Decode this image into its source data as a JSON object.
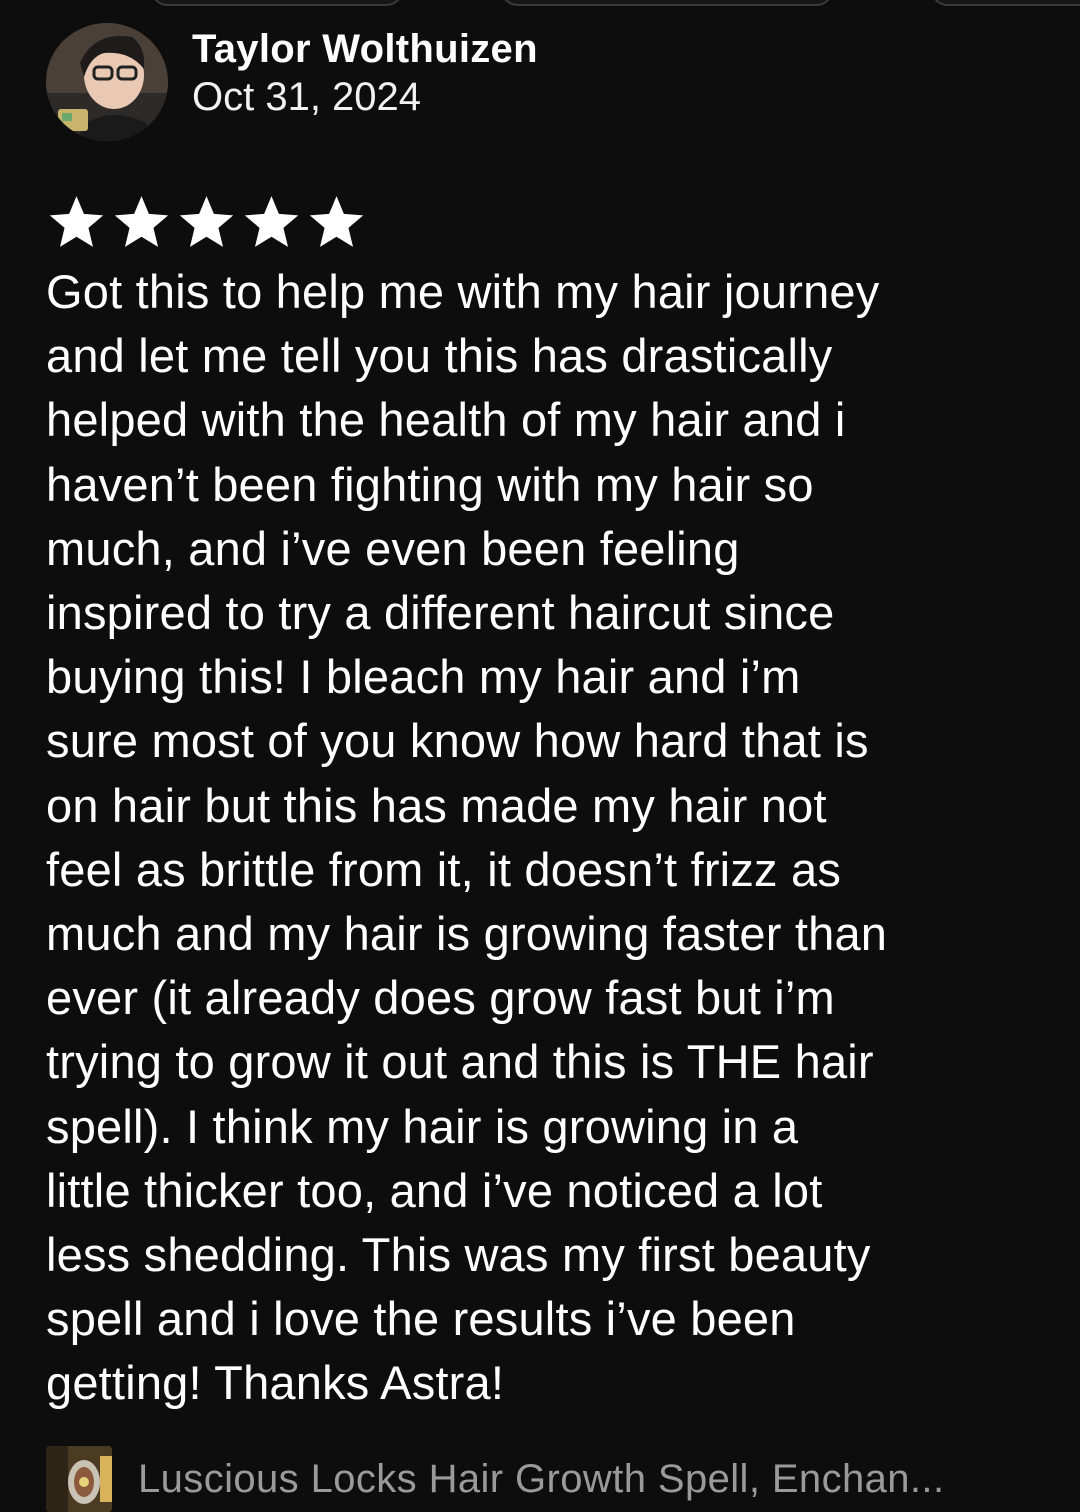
{
  "review": {
    "reviewer_name": "Taylor Wolthuizen",
    "date": "Oct 31, 2024",
    "rating": 5,
    "rating_max": 5,
    "star_color": "#ffffff",
    "lines": [
      "Got this to help me with my hair journey",
      "and let me tell you this has drastically",
      "helped with the health of my hair and i",
      "haven’t been fighting with my hair so",
      "much, and i’ve even been feeling",
      "inspired to try a different haircut since",
      "buying this! I bleach my hair and i’m",
      "sure most of you know how hard that is",
      "on hair but this has made my hair not",
      "feel as brittle from it, it doesn’t frizz as",
      "much and my hair is growing faster than",
      "ever (it already does grow fast but i’m",
      "trying to grow it out and this is THE hair",
      "spell). I think my hair is growing in a",
      "little thicker too, and i’ve noticed a lot",
      "less shedding. This was my first beauty",
      "spell and i love the results i’ve been",
      "getting! Thanks Astra!"
    ]
  },
  "product": {
    "title": "Luscious Locks Hair Growth Spell, Enchan..."
  },
  "colors": {
    "background": "#0d0d0d",
    "text": "#ffffff",
    "muted_text": "#9a9a9a"
  }
}
